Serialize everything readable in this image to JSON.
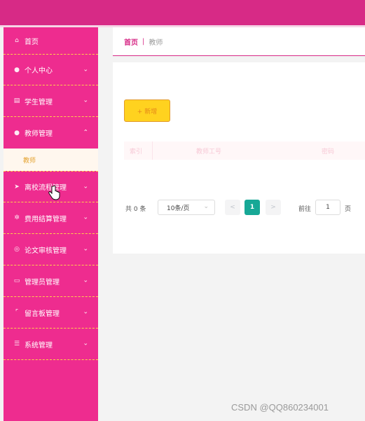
{
  "breadcrumb": {
    "home": "首页",
    "separator": "|",
    "current": "教师"
  },
  "sidebar": {
    "items": [
      {
        "label": "首页",
        "icon": "home-icon",
        "has_arrow": false
      },
      {
        "label": "个人中心",
        "icon": "user-icon",
        "arrow": "⌄"
      },
      {
        "label": "学生管理",
        "icon": "document-icon",
        "arrow": "⌄"
      },
      {
        "label": "教师管理",
        "icon": "user-icon",
        "arrow": "⌃"
      },
      {
        "label": "离校流程管理",
        "icon": "send-icon",
        "arrow": "⌄"
      },
      {
        "label": "费用结算管理",
        "icon": "gear-icon",
        "arrow": "⌄"
      },
      {
        "label": "论文审核管理",
        "icon": "circle-icon",
        "arrow": "⌄"
      },
      {
        "label": "管理员管理",
        "icon": "chat-icon",
        "arrow": "⌄"
      },
      {
        "label": "留言板管理",
        "icon": "frame-icon",
        "arrow": "⌄"
      },
      {
        "label": "系统管理",
        "icon": "layers-icon",
        "arrow": "⌄"
      }
    ],
    "submenu_teacher": "教师"
  },
  "toolbar": {
    "add_label": "+ 新增"
  },
  "table": {
    "headers": [
      "索引",
      "教师工号",
      "密码"
    ]
  },
  "pagination": {
    "total": "共 0 条",
    "page_size": "10条/页",
    "prev": "<",
    "current_page": "1",
    "next": ">",
    "goto_label": "前往",
    "goto_value": "1",
    "goto_suffix": "页"
  },
  "watermark": "CSDN @QQ860234001",
  "colors": {
    "accent": "#ee2c8f",
    "header": "#d72a86",
    "add_button": "#ffd21f",
    "active_page": "#17a896"
  }
}
